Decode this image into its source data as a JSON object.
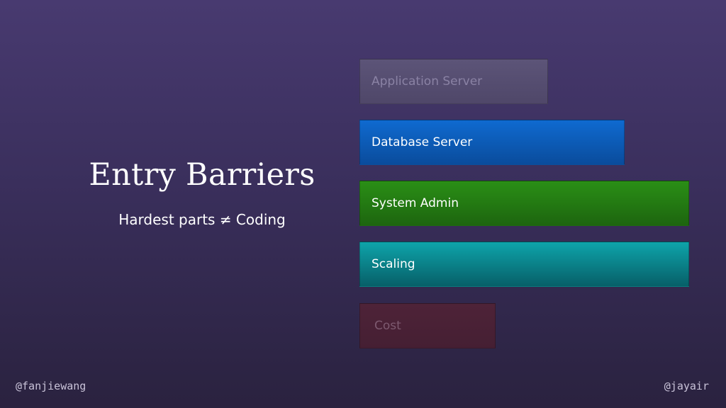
{
  "slide": {
    "title": "Entry Barriers",
    "subtitle": "Hardest parts ≠ Coding"
  },
  "stack": {
    "layers": [
      {
        "label": "Application Server",
        "color": "#5c5478"
      },
      {
        "label": "Database Server",
        "color": "#0f6ad0"
      },
      {
        "label": "System Admin",
        "color": "#2a8f16"
      },
      {
        "label": "Scaling",
        "color": "#0ea4aa"
      },
      {
        "label": "Cost",
        "color": "#4e2338"
      }
    ]
  },
  "footer": {
    "left_handle": "@fanjiewang",
    "right_handle": "@jayair"
  }
}
